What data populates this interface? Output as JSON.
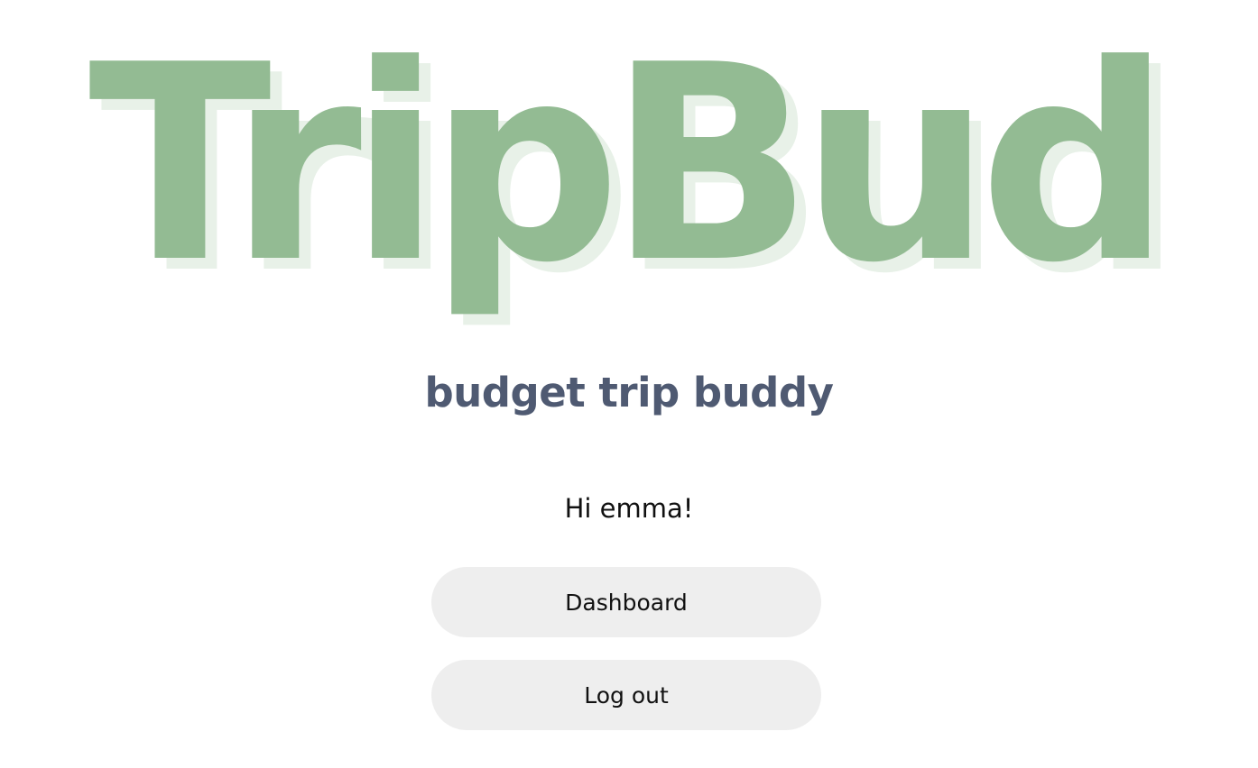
{
  "brand": {
    "logo_text": "TripBud",
    "logo_color": "#93bb93",
    "logo_shadow_color": "#e8f1e8",
    "tagline": "budget trip buddy",
    "tagline_color": "#4f5a72"
  },
  "greeting": {
    "text": "Hi emma!"
  },
  "actions": {
    "dashboard_label": "Dashboard",
    "logout_label": "Log out",
    "button_bg": "#eeeeee"
  }
}
